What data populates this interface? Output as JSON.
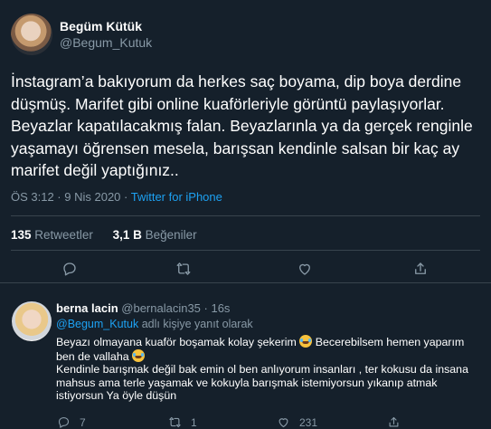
{
  "main_tweet": {
    "author_name": "Begüm Kütük",
    "author_handle": "@Begum_Kutuk",
    "text": "İnstagram’a bakıyorum da herkes saç boyama, dip boya derdine düşmüş. Marifet gibi online kuaförleriyle görüntü paylaşıyorlar. Beyazlar kapatılacakmış falan. Beyazlarınla ya da gerçek renginle yaşamayı öğrensen mesela, barışsan kendinle salsan bir kaç ay marifet değil yaptığınız..",
    "timestamp": "ÖS 3:12 · 9 Nis 2020 · ",
    "source": "Twitter for iPhone",
    "retweet_count": "135",
    "retweet_label": "Retweetler",
    "like_count": "3,1 B",
    "like_label": "Beğeniler",
    "action_icons": [
      "reply-icon",
      "retweet-icon",
      "like-icon",
      "share-icon"
    ]
  },
  "reply": {
    "author_name": "berna lacin",
    "author_handle": "@bernalacin35",
    "time": " · 16s",
    "reply_to_handle": "@Begum_Kutuk",
    "reply_to_suffix": " adlı kişiye yanıt olarak",
    "text_1": "Beyazı olmayana kuaför boşamak kolay şekerim ",
    "text_2": " Becerebilsem hemen yaparım ben de vallaha ",
    "text_3": "Kendinle barışmak değil bak emin ol ben anlıyorum insanları , ter kokusu da insana mahsus ama terle yaşamak ve kokuyla barışmak istemiyorsun yıkanıp atmak istiyorsun Ya öyle düşün",
    "emoji_icon": "tears-of-joy-emoji",
    "reply_count": "7",
    "retweet_count": "1",
    "like_count": "231"
  },
  "colors": {
    "background": "#15202b",
    "text": "#ffffff",
    "secondary": "#8899a6",
    "accent": "#1da1f2",
    "divider": "#38444d"
  }
}
